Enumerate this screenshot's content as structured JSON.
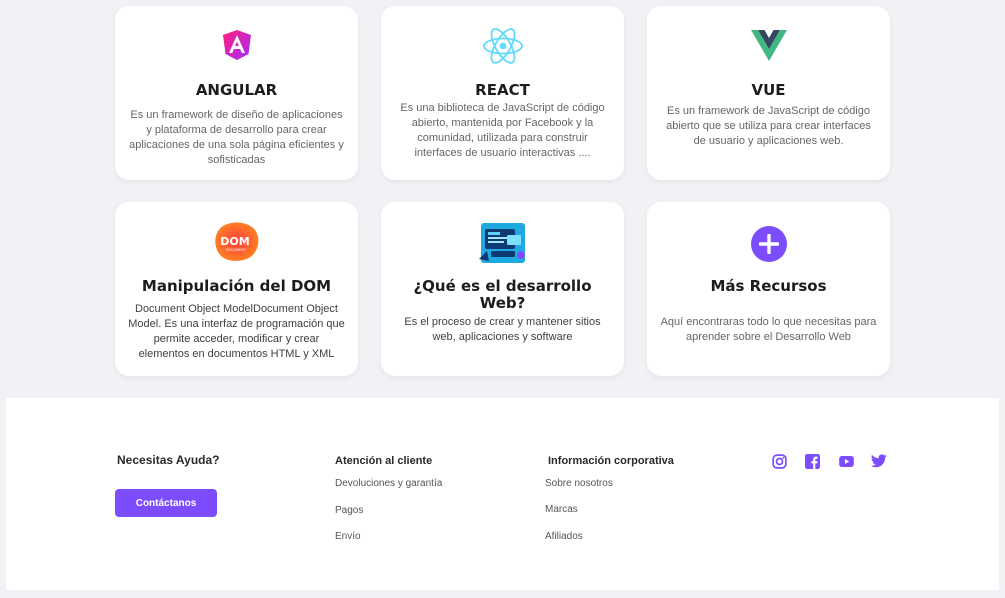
{
  "cards": [
    {
      "title": "ANGULAR",
      "desc": "Es un framework de diseño de aplicaciones y plataforma de desarrollo para crear aplicaciones de una sola página eficientes y sofisticadas",
      "icon": "angular-logo-icon"
    },
    {
      "title": "REACT",
      "desc": "Es una biblioteca de JavaScript de código abierto, mantenida por Facebook y la comunidad, utilizada para construir interfaces de usuario interactivas ....",
      "icon": "react-logo-icon"
    },
    {
      "title": "VUE",
      "desc": "Es un framework de JavaScript de código abierto que se utiliza para crear interfaces de usuario y aplicaciones web.",
      "icon": "vue-logo-icon"
    },
    {
      "title": "Manipulación del DOM",
      "desc": "Document Object ModelDocument Object Model. Es una interfaz de programación que permite acceder, modificar y crear elementos en documentos HTML y XML",
      "icon": "dom-logo-icon",
      "logo_text": "DOM",
      "logo_subtext": "DOCUMENT"
    },
    {
      "title": "¿Qué es el desarrollo Web?",
      "desc": "Es el proceso de crear y mantener sitios web, aplicaciones y software",
      "icon": "web-development-illustration-icon"
    },
    {
      "title": "Más Recursos",
      "desc": "Aquí encontraras todo lo que necesitas para aprender sobre el Desarrollo Web",
      "icon": "plus-circle-icon"
    }
  ],
  "footer": {
    "help_title": "Necesitas Ayuda?",
    "contact_label": "Contáctanos",
    "customer_title": "Atención al cliente",
    "customer_links": [
      "Devoluciones y garantía",
      "Pagos",
      "Envío"
    ],
    "corporate_title": "Información corporativa",
    "corporate_links": [
      "Sobre nosotros",
      "Marcas",
      "Afiliados"
    ],
    "social": [
      "instagram-icon",
      "facebook-icon",
      "youtube-icon",
      "twitter-icon"
    ]
  },
  "colors": {
    "accent": "#7c4dff",
    "angular": "#e91e63",
    "react": "#61dafb",
    "vue_green": "#41b883",
    "vue_dark": "#35495e",
    "dom": "#ff5722"
  }
}
